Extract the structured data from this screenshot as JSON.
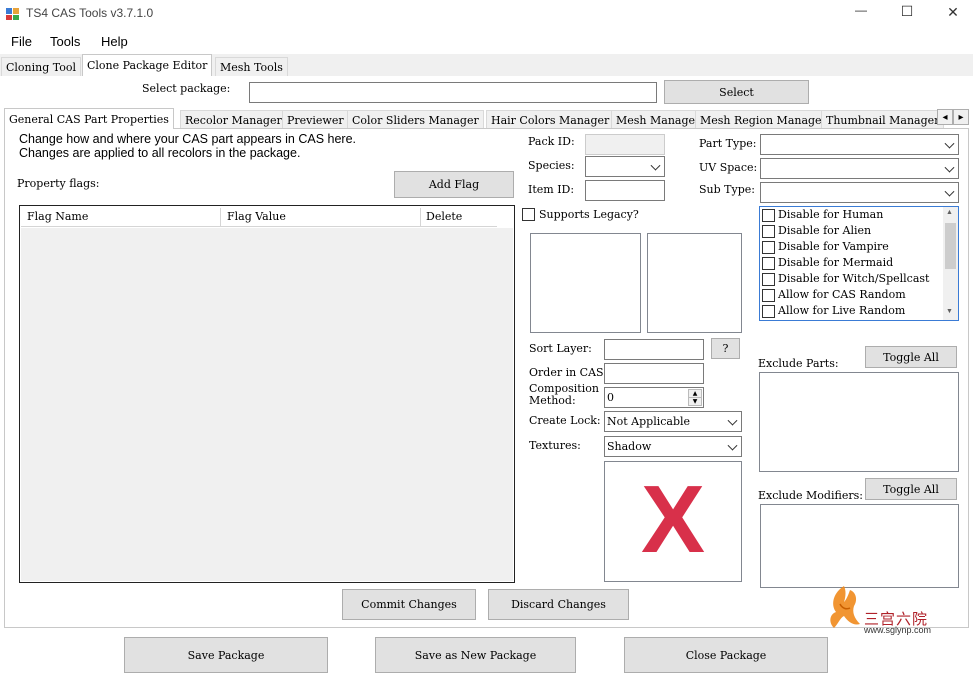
{
  "window": {
    "title": "TS4 CAS Tools v3.7.1.0",
    "controls": [
      "—",
      "☐",
      "✕"
    ]
  },
  "menu": [
    "File",
    "Tools",
    "Help"
  ],
  "top_tabs": [
    "Cloning Tool",
    "Clone Package Editor",
    "Mesh Tools"
  ],
  "select_package": {
    "label": "Select package:",
    "value": "",
    "button": "Select"
  },
  "sub_tabs": [
    "General CAS Part Properties",
    "Recolor Manager",
    "Previewer",
    "Color Sliders Manager",
    "Hair Colors Manager",
    "Mesh Manager",
    "Mesh Region Manager",
    "Thumbnail Manager"
  ],
  "tab_scroll": [
    "◂",
    "▸"
  ],
  "intro": [
    "Change how and where your CAS part appears in CAS here.",
    "Changes are applied to all recolors in the package."
  ],
  "flags": {
    "label": "Property flags:",
    "add_button": "Add Flag",
    "columns": [
      "Flag Name",
      "Flag Value",
      "Delete"
    ]
  },
  "fields": {
    "pack_id": {
      "label": "Pack ID:",
      "value": ""
    },
    "species": {
      "label": "Species:",
      "value": ""
    },
    "item_id": {
      "label": "Item ID:",
      "value": ""
    },
    "part_type": {
      "label": "Part Type:",
      "value": ""
    },
    "uv_space": {
      "label": "UV Space:",
      "value": ""
    },
    "sub_type": {
      "label": "Sub Type:",
      "value": ""
    },
    "supports_legacy": {
      "label": "Supports Legacy?",
      "checked": false
    },
    "sort_layer": {
      "label": "Sort Layer:",
      "value": "",
      "help": "?"
    },
    "order_in_cas": {
      "label": "Order in CAS:",
      "value": ""
    },
    "composition_method": {
      "label_line1": "Composition",
      "label_line2": "Method:",
      "value": "0"
    },
    "create_lock": {
      "label": "Create Lock:",
      "value": "Not Applicable"
    },
    "textures": {
      "label": "Textures:",
      "value": "Shadow"
    }
  },
  "occult_flags": [
    {
      "label": "Disable for Human",
      "checked": false
    },
    {
      "label": "Disable for Alien",
      "checked": false
    },
    {
      "label": "Disable for Vampire",
      "checked": false
    },
    {
      "label": "Disable for Mermaid",
      "checked": false
    },
    {
      "label": "Disable for Witch/Spellcast",
      "checked": false
    },
    {
      "label": "Allow for CAS Random",
      "checked": false
    },
    {
      "label": "Allow for Live Random",
      "checked": false
    }
  ],
  "exclude_parts": {
    "label": "Exclude Parts:",
    "button": "Toggle All"
  },
  "exclude_modifiers": {
    "label": "Exclude Modifiers:",
    "button": "Toggle All"
  },
  "texture_preview": {
    "placeholder": "X",
    "color": "#d8304a"
  },
  "actions": {
    "commit": "Commit Changes",
    "discard": "Discard Changes"
  },
  "footer": {
    "save": "Save Package",
    "save_new": "Save as New Package",
    "close": "Close Package"
  },
  "watermark": {
    "brand": "三宫六院",
    "url": "www.sglynp.com"
  }
}
